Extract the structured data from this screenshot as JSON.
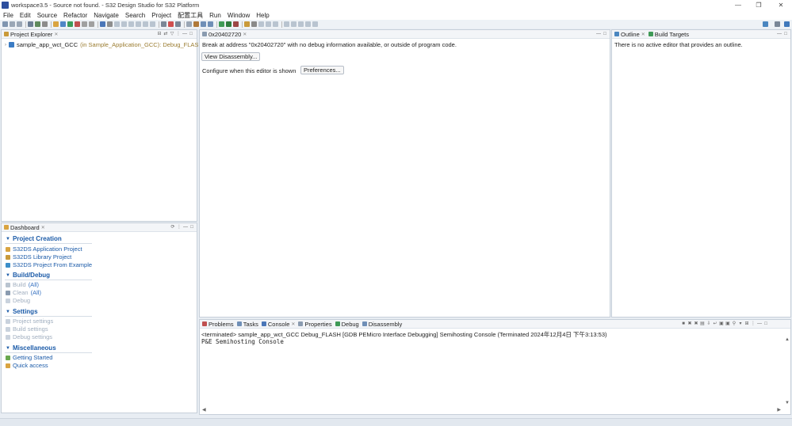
{
  "window": {
    "title": "workspace3.5 - Source not found. - S32 Design Studio for S32 Platform",
    "minimize": "—",
    "restore": "❐",
    "close": "✕"
  },
  "menu": [
    "File",
    "Edit",
    "Source",
    "Refactor",
    "Navigate",
    "Search",
    "Project",
    "配置工具",
    "Run",
    "Window",
    "Help"
  ],
  "project_explorer": {
    "tab_label": "Project Explorer",
    "project_name": "sample_app_wct_GCC",
    "project_decoration": "(in Sample_Application_GCC): Debug_FLASH"
  },
  "editor": {
    "tab_label": "0x20402720",
    "message": "Break at address \"0x20402720\" with no debug information available, or outside of program code.",
    "view_disassembly_button": "View Disassembly...",
    "configure_label": "Configure when this editor is shown",
    "preferences_button": "Preferences..."
  },
  "outline": {
    "tab_label": "Outline",
    "build_targets_tab": "Build Targets",
    "message": "There is no active editor that provides an outline."
  },
  "dashboard": {
    "tab_label": "Dashboard",
    "sections": {
      "project_creation": {
        "title": "Project Creation",
        "items": [
          "S32DS Application Project",
          "S32DS Library Project",
          "S32DS Project From Example"
        ]
      },
      "build_debug": {
        "title": "Build/Debug",
        "build": "Build",
        "build_all": "(All)",
        "clean": "Clean",
        "clean_all": "(All)",
        "debug": "Debug"
      },
      "settings": {
        "title": "Settings",
        "items": [
          "Project settings",
          "Build settings",
          "Debug settings"
        ]
      },
      "miscellaneous": {
        "title": "Miscellaneous",
        "items": [
          "Getting Started",
          "Quick access"
        ]
      }
    }
  },
  "console": {
    "tabs": [
      "Problems",
      "Tasks",
      "Console",
      "Properties",
      "Debug",
      "Disassembly"
    ],
    "status_line": "<terminated> sample_app_wct_GCC Debug_FLASH [GDB PEMicro Interface Debugging] Semihosting Console (Terminated 2024年12月4日 下午3:13:53)",
    "output": "P&E Semihosting Console"
  },
  "colors": {
    "accent": "#1a5aa8",
    "disabled": "#a0aebf",
    "decoration": "#9a7b2f",
    "chrome": "#e8edf3"
  }
}
